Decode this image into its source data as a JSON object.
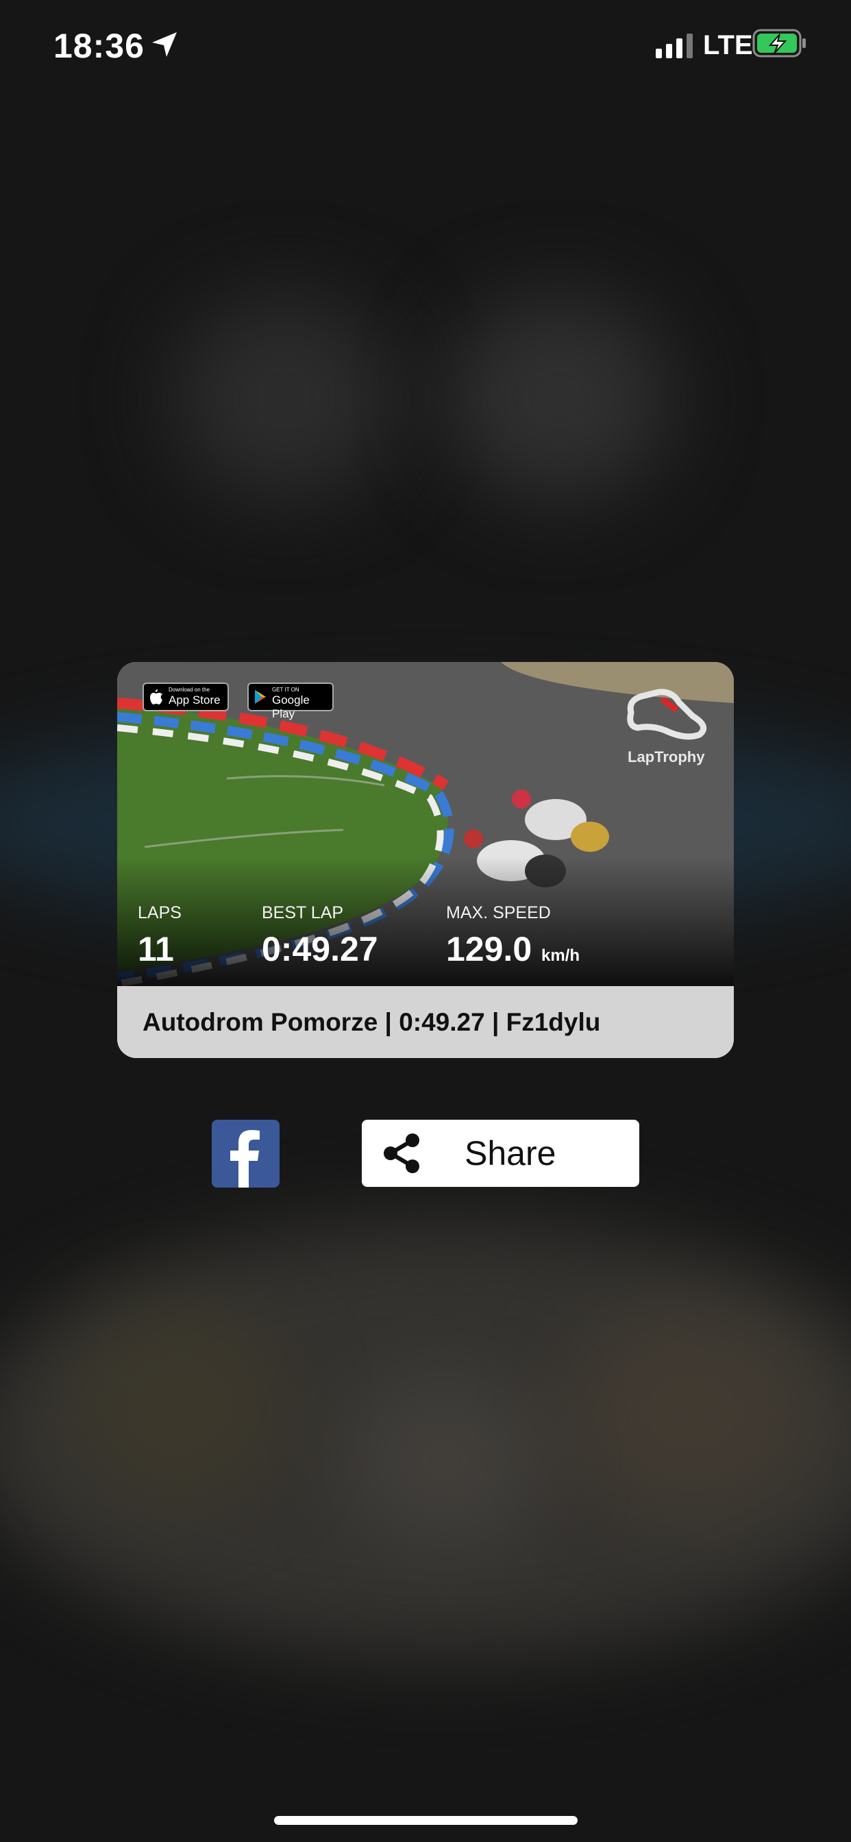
{
  "status_bar": {
    "time": "18:36",
    "network": "LTE",
    "icons": [
      "location-arrow-icon",
      "signal-bars-icon",
      "battery-charging-icon"
    ],
    "battery_color": "#34c759"
  },
  "card": {
    "badges": {
      "app_store_small": "Download on the",
      "app_store_big": "App Store",
      "google_play_small": "GET IT ON",
      "google_play_big": "Google Play"
    },
    "brand": "LapTrophy",
    "stats": {
      "laps_label": "LAPS",
      "laps_value": "11",
      "best_lap_label": "BEST LAP",
      "best_lap_value": "0:49.27",
      "max_speed_label": "MAX. SPEED",
      "max_speed_value": "129.0",
      "max_speed_unit": "km/h"
    },
    "caption": "Autodrom Pomorze | 0:49.27 | Fz1dylu"
  },
  "actions": {
    "facebook_icon": "facebook-icon",
    "share_label": "Share",
    "share_icon": "share-icon",
    "facebook_color": "#3b5998"
  }
}
